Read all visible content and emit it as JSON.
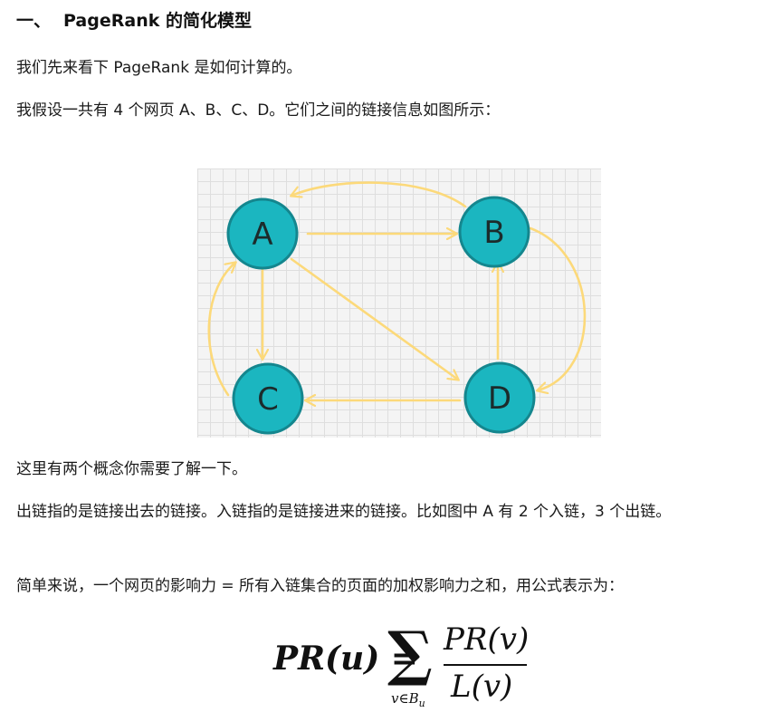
{
  "heading": {
    "number": "一、",
    "title": "PageRank 的简化模型"
  },
  "paragraphs": {
    "intro": "我们先来看下 PageRank 是如何计算的。",
    "assume": "我假设一共有 4 个网页 A、B、C、D。它们之间的链接信息如图所示：",
    "concepts": "这里有两个概念你需要了解一下。",
    "links": "出链指的是链接出去的链接。入链指的是链接进来的链接。比如图中 A 有 2 个入链，3 个出链。",
    "summary": "简单来说，一个网页的影响力 = 所有入链集合的页面的加权影响力之和，用公式表示为："
  },
  "diagram": {
    "node_color": "#1bb6c0",
    "node_stroke": "#14868e",
    "edge_color": "#fcd97a",
    "nodes": [
      "A",
      "B",
      "C",
      "D"
    ],
    "edges": [
      {
        "from": "A",
        "to": "B"
      },
      {
        "from": "B",
        "to": "A"
      },
      {
        "from": "A",
        "to": "C"
      },
      {
        "from": "A",
        "to": "D"
      },
      {
        "from": "B",
        "to": "D"
      },
      {
        "from": "C",
        "to": "A"
      },
      {
        "from": "D",
        "to": "B"
      },
      {
        "from": "D",
        "to": "C"
      }
    ]
  },
  "formula": {
    "lhs": "PR(u) =",
    "sigma": "∑",
    "subscript": "v∈B",
    "subscript_sub": "u",
    "numerator": "PR(v)",
    "denominator": "L(v)"
  }
}
